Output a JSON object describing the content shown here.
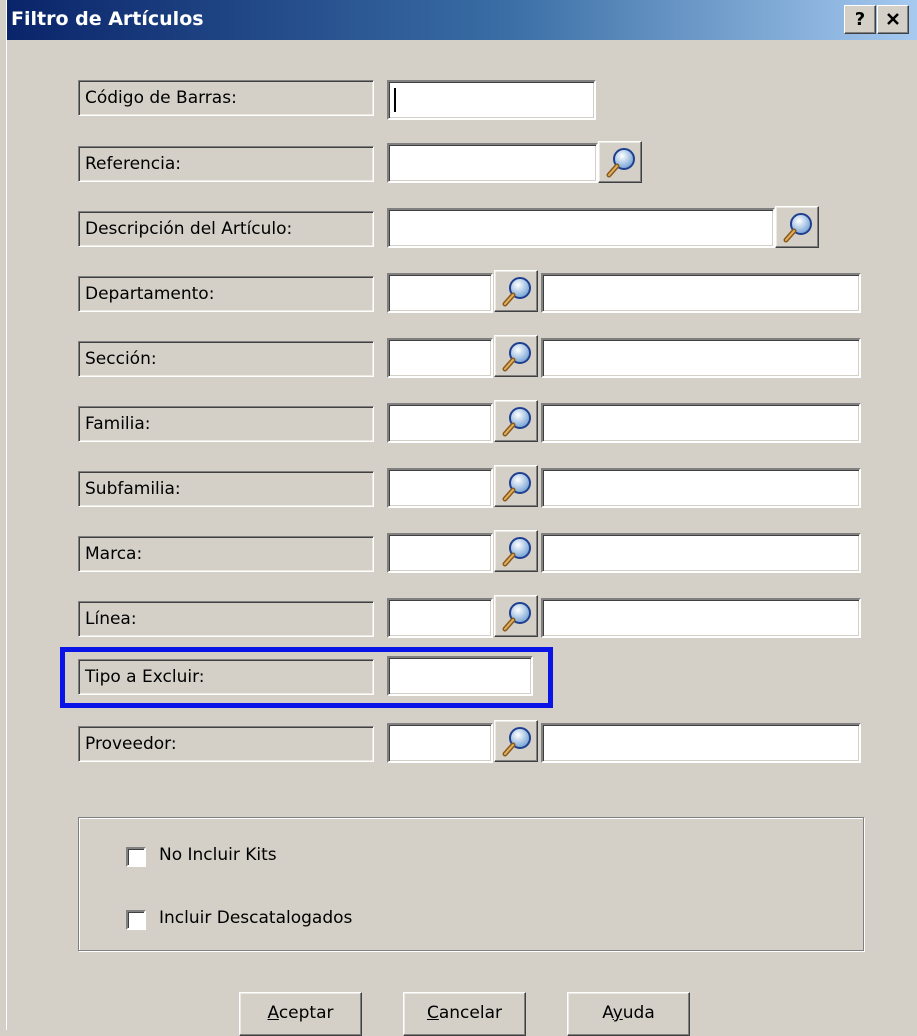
{
  "dialog": {
    "title": "Filtro de Artículos",
    "help_button": "?",
    "close_button": "✕"
  },
  "fields": {
    "codigo_barras": {
      "label": "Código de Barras:",
      "value": ""
    },
    "referencia": {
      "label": "Referencia:",
      "value": ""
    },
    "descripcion": {
      "label": "Descripción del Artículo:",
      "value": ""
    },
    "departamento": {
      "label": "Departamento:",
      "code": "",
      "description": ""
    },
    "seccion": {
      "label": "Sección:",
      "code": "",
      "description": ""
    },
    "familia": {
      "label": "Familia:",
      "code": "",
      "description": ""
    },
    "subfamilia": {
      "label": "Subfamilia:",
      "code": "",
      "description": ""
    },
    "marca": {
      "label": "Marca:",
      "code": "",
      "description": ""
    },
    "linea": {
      "label": "Línea:",
      "code": "",
      "description": ""
    },
    "tipo_excluir": {
      "label": "Tipo a Excluir:",
      "value": "",
      "highlighted": true,
      "highlight_color": "#0a14e6"
    },
    "proveedor": {
      "label": "Proveedor:",
      "code": "",
      "description": ""
    }
  },
  "options": {
    "no_incluir_kits": {
      "label": "No Incluir Kits",
      "checked": false
    },
    "incluir_descatalogados": {
      "label": "Incluir Descatalogados",
      "checked": false
    }
  },
  "buttons": {
    "aceptar": {
      "mnemonic": "A",
      "rest": "ceptar"
    },
    "cancelar": {
      "mnemonic": "C",
      "rest": "ancelar"
    },
    "ayuda": {
      "before": "A",
      "mnemonic": "y",
      "rest": "uda"
    }
  },
  "icons": {
    "lookup": "magnifier-icon"
  },
  "colors": {
    "titlebar_start": "#0a246a",
    "titlebar_end": "#a6caf0",
    "face": "#d4d0c8"
  }
}
